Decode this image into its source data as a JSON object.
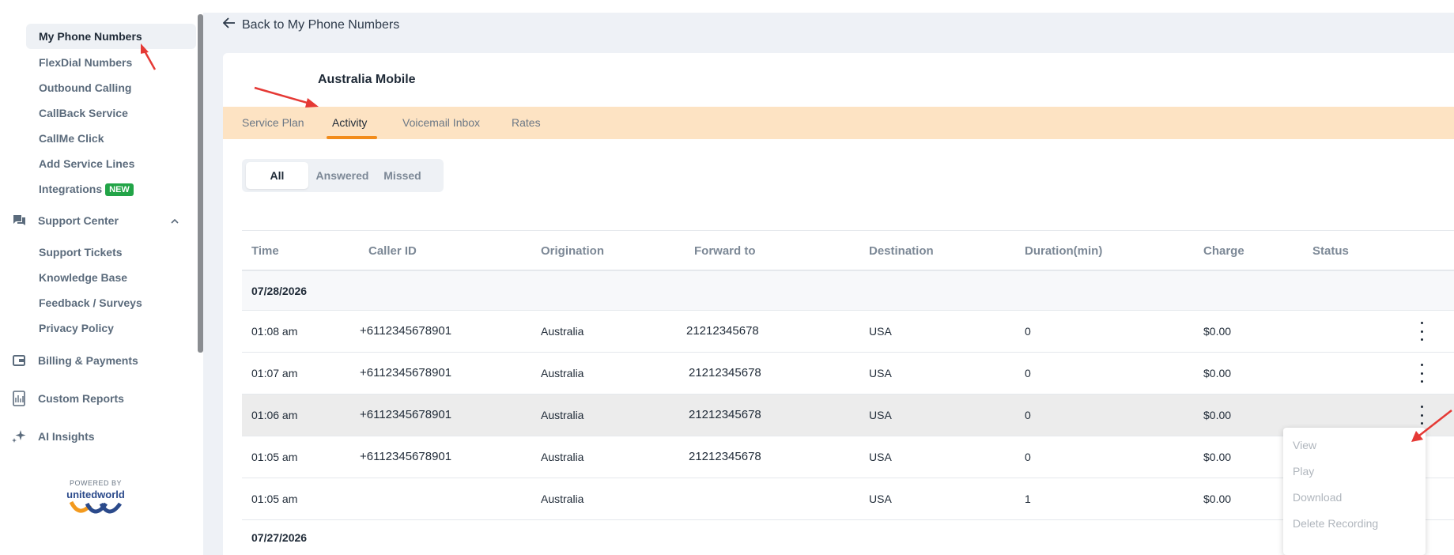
{
  "sidebar": {
    "items": [
      {
        "label": "My Phone Numbers"
      },
      {
        "label": "FlexDial Numbers"
      },
      {
        "label": "Outbound Calling"
      },
      {
        "label": "CallBack Service"
      },
      {
        "label": "CallMe Click"
      },
      {
        "label": "Add Service Lines"
      },
      {
        "label": "Integrations",
        "badge": "NEW"
      }
    ],
    "support_center": {
      "label": "Support Center",
      "icon": "chat-icon",
      "expanded": true
    },
    "support_items": [
      {
        "label": "Support Tickets"
      },
      {
        "label": "Knowledge Base"
      },
      {
        "label": "Feedback / Surveys"
      },
      {
        "label": "Privacy Policy"
      }
    ],
    "billing": {
      "label": "Billing & Payments",
      "icon": "wallet-icon"
    },
    "reports": {
      "label": "Custom Reports",
      "icon": "report-icon"
    },
    "ai": {
      "label": "AI Insights",
      "icon": "sparkle-icon"
    },
    "powered_by": "POWERED BY",
    "logo_text": "unitedworld"
  },
  "main": {
    "back_label": "Back to My Phone Numbers",
    "title": "Australia Mobile",
    "tabs": [
      {
        "label": "Service Plan"
      },
      {
        "label": "Activity",
        "active": true
      },
      {
        "label": "Voicemail Inbox"
      },
      {
        "label": "Rates"
      }
    ],
    "filters": [
      {
        "label": "All",
        "active": true
      },
      {
        "label": "Answered"
      },
      {
        "label": "Missed"
      }
    ],
    "columns": [
      "Time",
      "Caller ID",
      "Origination",
      "Forward to",
      "Destination",
      "Duration(min)",
      "Charge",
      "Status"
    ],
    "groups": [
      {
        "date": "07/28/2026",
        "rows": [
          {
            "time": "01:08 am",
            "caller": "+6112345678901",
            "origination": "Australia",
            "forward": "21212345678",
            "destination": "USA",
            "duration": "0",
            "charge": "$0.00"
          },
          {
            "time": "01:07 am",
            "caller": "+6112345678901",
            "origination": "Australia",
            "forward": "21212345678",
            "destination": "USA",
            "duration": "0",
            "charge": "$0.00"
          },
          {
            "time": "01:06 am",
            "caller": "+6112345678901",
            "origination": "Australia",
            "forward": "21212345678",
            "destination": "USA",
            "duration": "0",
            "charge": "$0.00"
          },
          {
            "time": "01:05 am",
            "caller": "+6112345678901",
            "origination": "Australia",
            "forward": "21212345678",
            "destination": "USA",
            "duration": "0",
            "charge": "$0.00"
          },
          {
            "time": "01:05 am",
            "caller": "",
            "origination": "Australia",
            "forward": "",
            "destination": "USA",
            "duration": "1",
            "charge": "$0.00"
          }
        ]
      },
      {
        "date": "07/27/2026"
      }
    ],
    "row_menu": [
      "View",
      "Play",
      "Download",
      "Delete Recording"
    ]
  },
  "colors": {
    "accent": "#f28c1b",
    "tabbar_bg": "#fde3c3",
    "badge_green": "#22a447",
    "annotation_red": "#e53935"
  }
}
